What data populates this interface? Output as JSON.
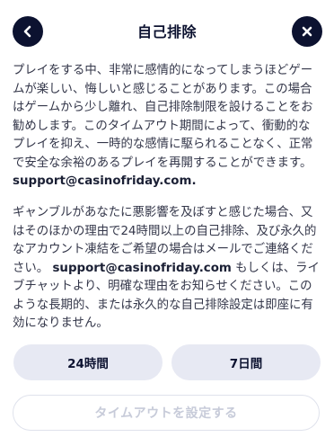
{
  "header": {
    "title": "自己排除",
    "back_icon": "chevron-left-icon",
    "close_icon": "close-icon"
  },
  "body": {
    "paragraph1_text": "プレイをする中、非常に感情的になってしまうほどゲームが楽しい、悔しいと感じることがあります。この場合はゲームから少し離れ、自己排除制限を設けることをお勧めします。このタイムアウト期間によって、衝動的なプレイを抑え、一時的な感情に駆られることなく、正常で安全な余裕のあるプレイを再開することができます。",
    "paragraph1_email": "support@casinofriday.com.",
    "paragraph2_text_a": "ギャンブルがあなたに悪影響を及ぼすと感じた場合、又はそのほかの理由で24時間以上の自己排除、及び永久的なアカウント凍結をご希望の場合はメールでご連絡ください。",
    "paragraph2_email": "support@casinofriday.com",
    "paragraph2_text_b": "もしくは、ライブチャットより、明確な理由をお知らせください。このような長期的、または永久的な自己排除設定は即座に有効になりません。"
  },
  "durations": {
    "option_24h": "24時間",
    "option_7d": "7日間"
  },
  "actions": {
    "submit_label": "タイムアウトを設定する"
  },
  "colors": {
    "primary_dark": "#0c1230",
    "option_bg": "#e7e9f3",
    "disabled_text": "#c7cbd9"
  }
}
